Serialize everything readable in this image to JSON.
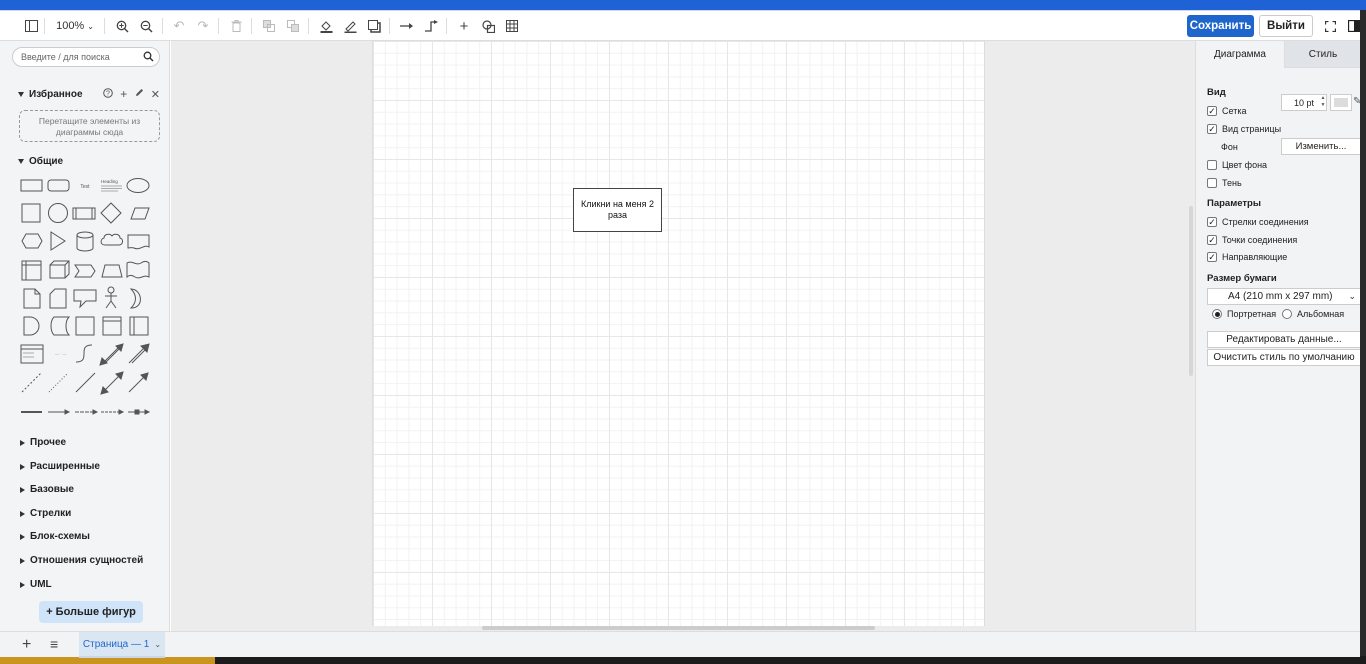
{
  "toolbar": {
    "zoom": "100%",
    "save_label": "Сохранить",
    "exit_label": "Выйти"
  },
  "sidebar": {
    "search_placeholder": "Введите / для поиска",
    "favorites": {
      "title": "Избранное",
      "dropzone_text": "Перетащите элементы из диаграммы сюда"
    },
    "general_title": "Общие",
    "sections": [
      "Прочее",
      "Расширенные",
      "Базовые",
      "Стрелки",
      "Блок-схемы",
      "Отношения сущностей",
      "UML"
    ],
    "more_shapes_label": "+ Больше фигур"
  },
  "canvas": {
    "box_text": "Кликни на меня 2 раза"
  },
  "format_panel": {
    "tabs": [
      "Диаграмма",
      "Стиль"
    ],
    "view_title": "Вид",
    "grid_label": "Сетка",
    "grid_checked": true,
    "grid_size": "10 pt",
    "page_view_label": "Вид страницы",
    "page_view_checked": true,
    "background_label": "Фон",
    "change_label": "Изменить...",
    "bg_color_label": "Цвет фона",
    "bg_color_checked": false,
    "shadow_label": "Тень",
    "shadow_checked": false,
    "params_title": "Параметры",
    "connection_arrows_label": "Стрелки соединения",
    "connection_arrows_checked": true,
    "connection_points_label": "Точки соединения",
    "connection_points_checked": true,
    "guides_label": "Направляющие",
    "guides_checked": true,
    "paper_size_title": "Размер бумаги",
    "paper_size_value": "A4 (210 mm x 297 mm)",
    "portrait_label": "Портретная",
    "landscape_label": "Альбомная",
    "orientation": "portrait",
    "edit_data_label": "Редактировать данные...",
    "clear_style_label": "Очистить стиль по умолчанию"
  },
  "bottom_bar": {
    "page_tab": "Страница — 1"
  },
  "colors": {
    "accent": "#1f66cc",
    "top_strip": "#1e62d6",
    "more_shapes_bg": "#cfe4f8"
  }
}
